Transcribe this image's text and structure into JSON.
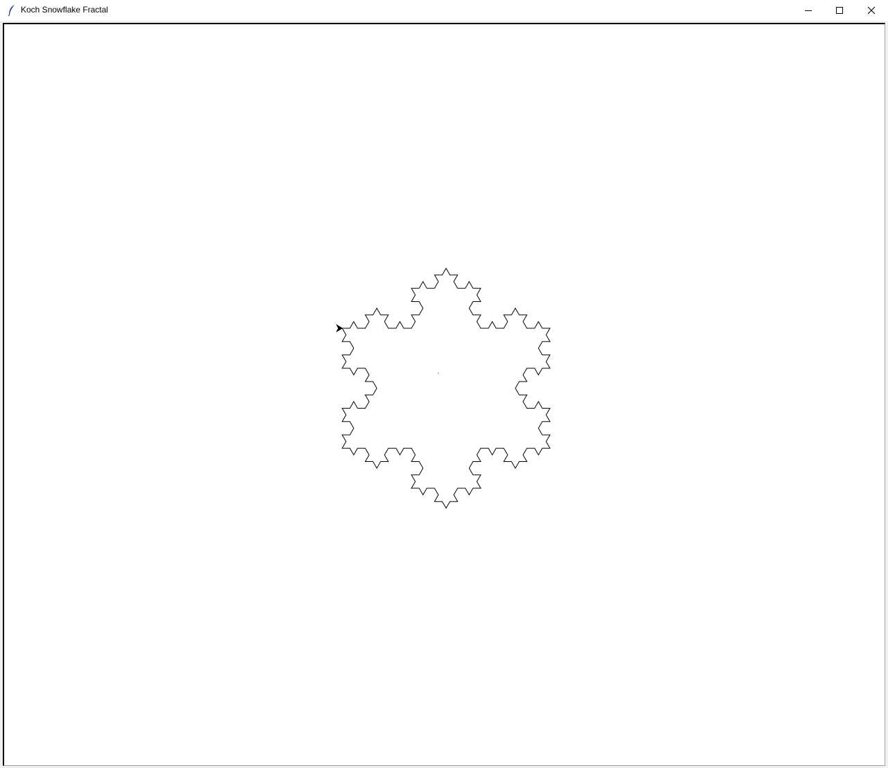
{
  "window": {
    "title": "Koch Snowflake Fractal",
    "app_icon": "feather-icon",
    "controls": {
      "minimize_icon": "minimize-icon",
      "maximize_icon": "maximize-icon",
      "close_icon": "close-icon"
    }
  },
  "canvas": {
    "background": "#ffffff",
    "drawing": {
      "shape": "koch-snowflake",
      "recursion_depth": 3,
      "line_color": "#000000",
      "turtle_color": "#000000",
      "turtle_icon": "turtle-arrow-icon",
      "center_mark_color": "#33cc33"
    }
  }
}
